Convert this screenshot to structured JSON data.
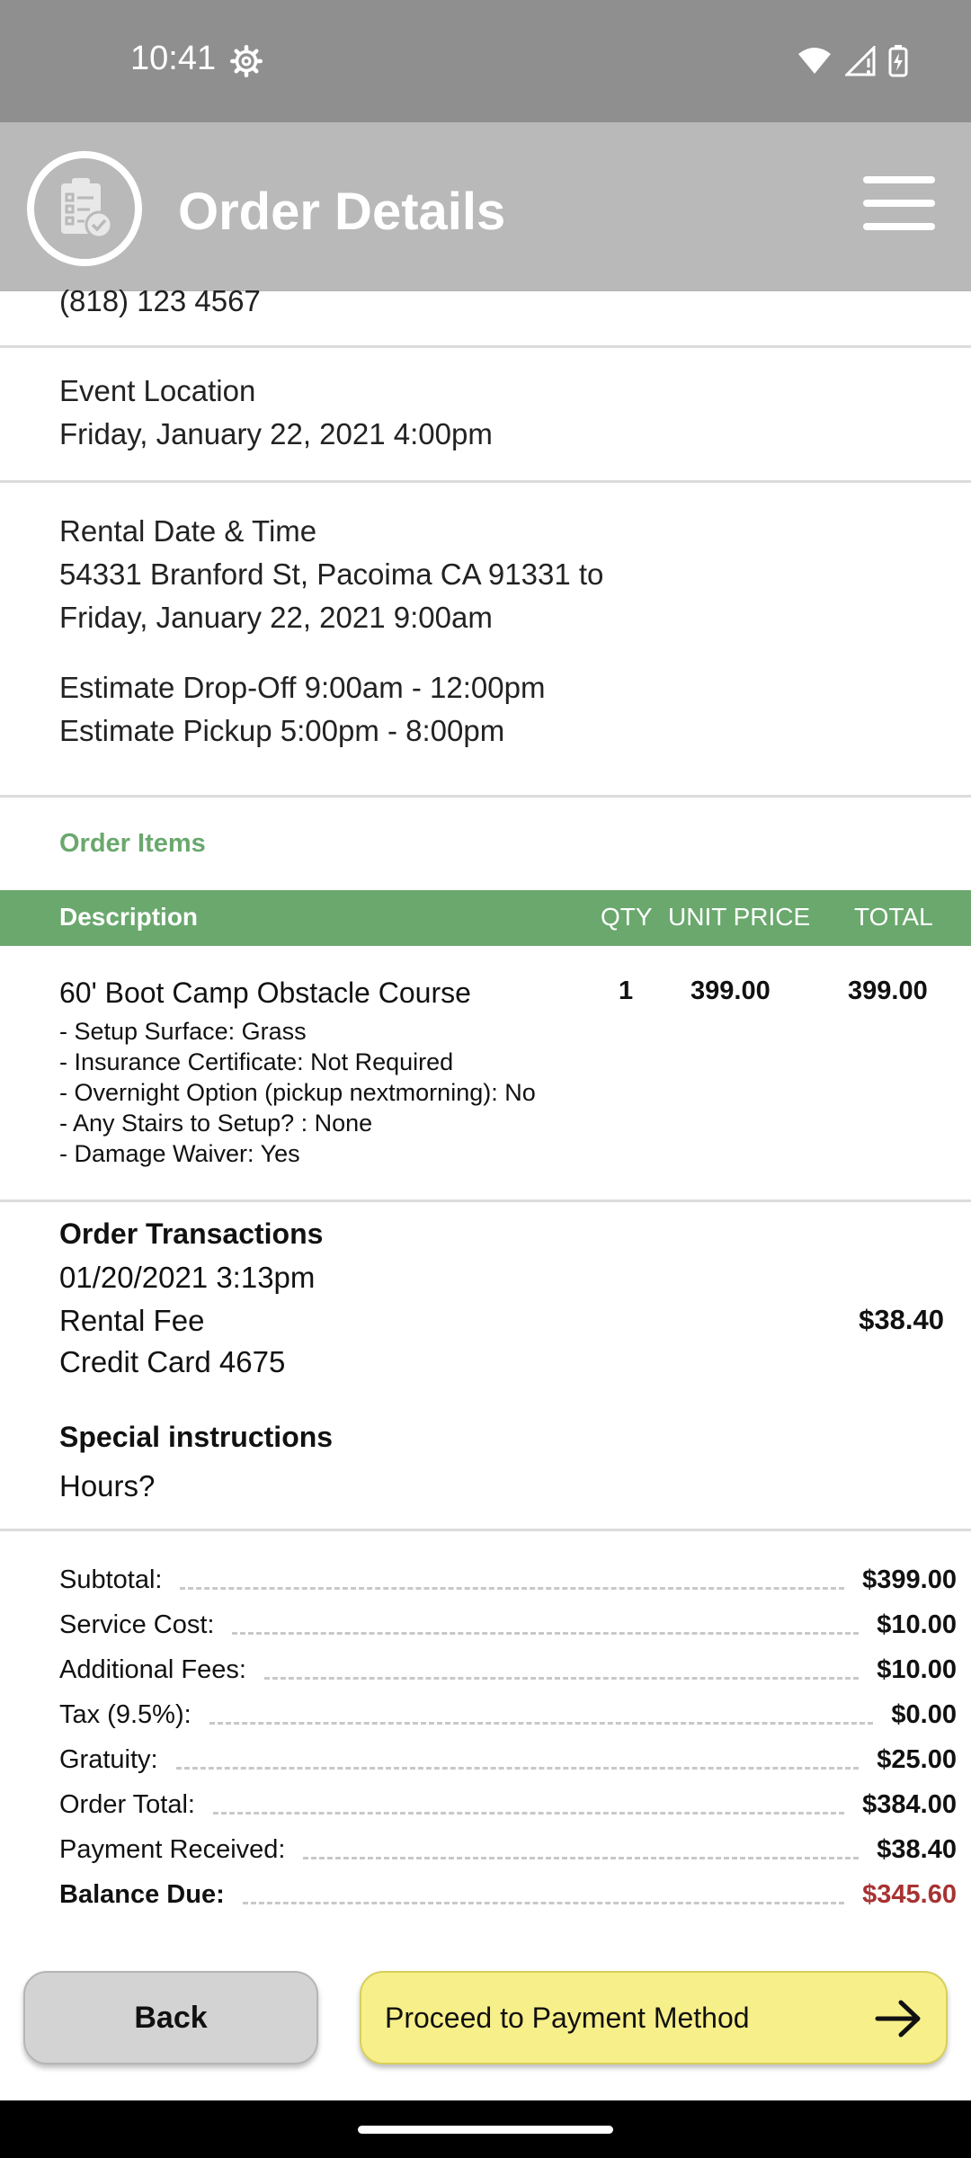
{
  "status": {
    "time": "10:41"
  },
  "app_bar": {
    "title": "Order Details"
  },
  "contact": {
    "phone": "(818) 123 4567"
  },
  "event": {
    "label": "Event Location",
    "value": "Friday, January 22, 2021 4:00pm"
  },
  "rental": {
    "label": "Rental Date & Time",
    "line1": "54331 Branford St, Pacoima CA 91331 to",
    "line2": "Friday, January 22, 2021 9:00am",
    "dropoff": "Estimate Drop-Off 9:00am - 12:00pm",
    "pickup": "Estimate Pickup 5:00pm - 8:00pm"
  },
  "order_items": {
    "label": "Order Items",
    "columns": {
      "description": "Description",
      "qty": "QTY",
      "unit_price": "UNIT PRICE",
      "total": "TOTAL"
    },
    "items": [
      {
        "name": "60' Boot Camp Obstacle Course",
        "qty": "1",
        "unit_price": "399.00",
        "total": "399.00",
        "options": [
          "- Setup Surface: Grass",
          "- Insurance Certificate: Not Required",
          "- Overnight Option (pickup nextmorning): No",
          "- Any Stairs to Setup? : None",
          "- Damage Waiver: Yes"
        ]
      }
    ]
  },
  "transactions": {
    "title": "Order Transactions",
    "date": "01/20/2021 3:13pm",
    "type": "Rental Fee",
    "amount": "$38.40",
    "method": "Credit Card 4675"
  },
  "special": {
    "title": "Special instructions",
    "text": "Hours?"
  },
  "summary": [
    {
      "label": "Subtotal:",
      "value": "$399.00"
    },
    {
      "label": "Service Cost:",
      "value": "$10.00"
    },
    {
      "label": "Additional Fees:",
      "value": "$10.00"
    },
    {
      "label": "Tax (9.5%):",
      "value": "$0.00"
    },
    {
      "label": "Gratuity:",
      "value": "$25.00"
    },
    {
      "label": "Order Total:",
      "value": "$384.00"
    },
    {
      "label": "Payment Received:",
      "value": "$38.40"
    },
    {
      "label": "Balance Due:",
      "value": "$345.60"
    }
  ],
  "buttons": {
    "back": "Back",
    "proceed": "Proceed to Payment Method"
  },
  "colors": {
    "accent_green": "#6aa86d",
    "balance_red": "#a83232",
    "proceed_yellow": "#f7f08a"
  }
}
